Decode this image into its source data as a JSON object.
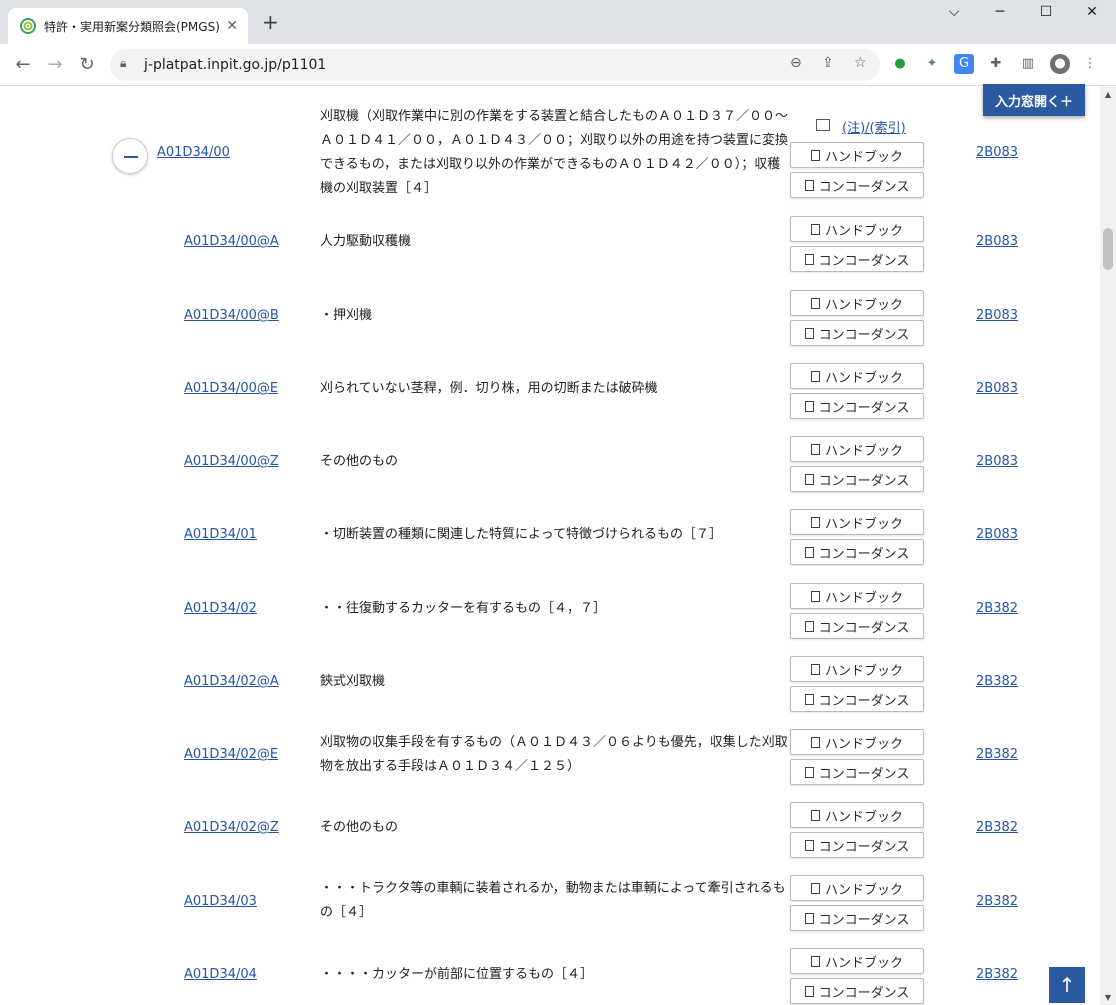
{
  "browser": {
    "tab_title": "特許・実用新案分類照会(PMGS) |",
    "tab_close": "✕",
    "new_tab": "+",
    "url": "j-platpat.inpit.go.jp/p1101",
    "minimize": "⌵",
    "restore": "─",
    "maximize": "☐",
    "close": "✕"
  },
  "page": {
    "open_input_label": "入力窓開く＋",
    "note_label": "(注)/(索引)",
    "handbook_label": "ハンドブック",
    "concordance_label": "コンコーダンス",
    "scroll_top_label": "↑"
  },
  "entries": [
    {
      "code": "A01D34/00",
      "desc": "刈取機（刈取作業中に別の作業をする装置と結合したものＡ０１Ｄ３７／００〜Ａ０１Ｄ４１／００，Ａ０１Ｄ４３／００；刈取り以外の用途を持つ装置に変換できるもの，または刈取り以外の作業ができるものＡ０１Ｄ４２／００）；収穫機の刈取装置［４］",
      "theme": "2B083"
    },
    {
      "code": "A01D34/00@A",
      "desc": "人力駆動収穫機",
      "theme": "2B083"
    },
    {
      "code": "A01D34/00@B",
      "desc": "・押刈機",
      "theme": "2B083"
    },
    {
      "code": "A01D34/00@E",
      "desc": "刈られていない茎稈，例．切り株，用の切断または破砕機",
      "theme": "2B083"
    },
    {
      "code": "A01D34/00@Z",
      "desc": "その他のもの",
      "theme": "2B083"
    },
    {
      "code": "A01D34/01",
      "desc": "・切断装置の種類に関連した特質によって特徴づけられるもの［７］",
      "theme": "2B083"
    },
    {
      "code": "A01D34/02",
      "desc": "・・往復動するカッターを有するもの［４，７］",
      "theme": "2B382"
    },
    {
      "code": "A01D34/02@A",
      "desc": "鋏式刈取機",
      "theme": "2B382"
    },
    {
      "code": "A01D34/02@E",
      "desc": "刈取物の収集手段を有するもの（Ａ０１Ｄ４３／０６よりも優先，収集した刈取物を放出する手段はＡ０１Ｄ３４／１２５）",
      "theme": "2B382"
    },
    {
      "code": "A01D34/02@Z",
      "desc": "その他のもの",
      "theme": "2B382"
    },
    {
      "code": "A01D34/03",
      "desc": "・・・トラクタ等の車輌に装着されるか，動物または車輌によって牽引されるもの［４］",
      "theme": "2B382"
    },
    {
      "code": "A01D34/04",
      "desc": "・・・・カッターが前部に位置するもの［４］",
      "theme": "2B382"
    }
  ]
}
